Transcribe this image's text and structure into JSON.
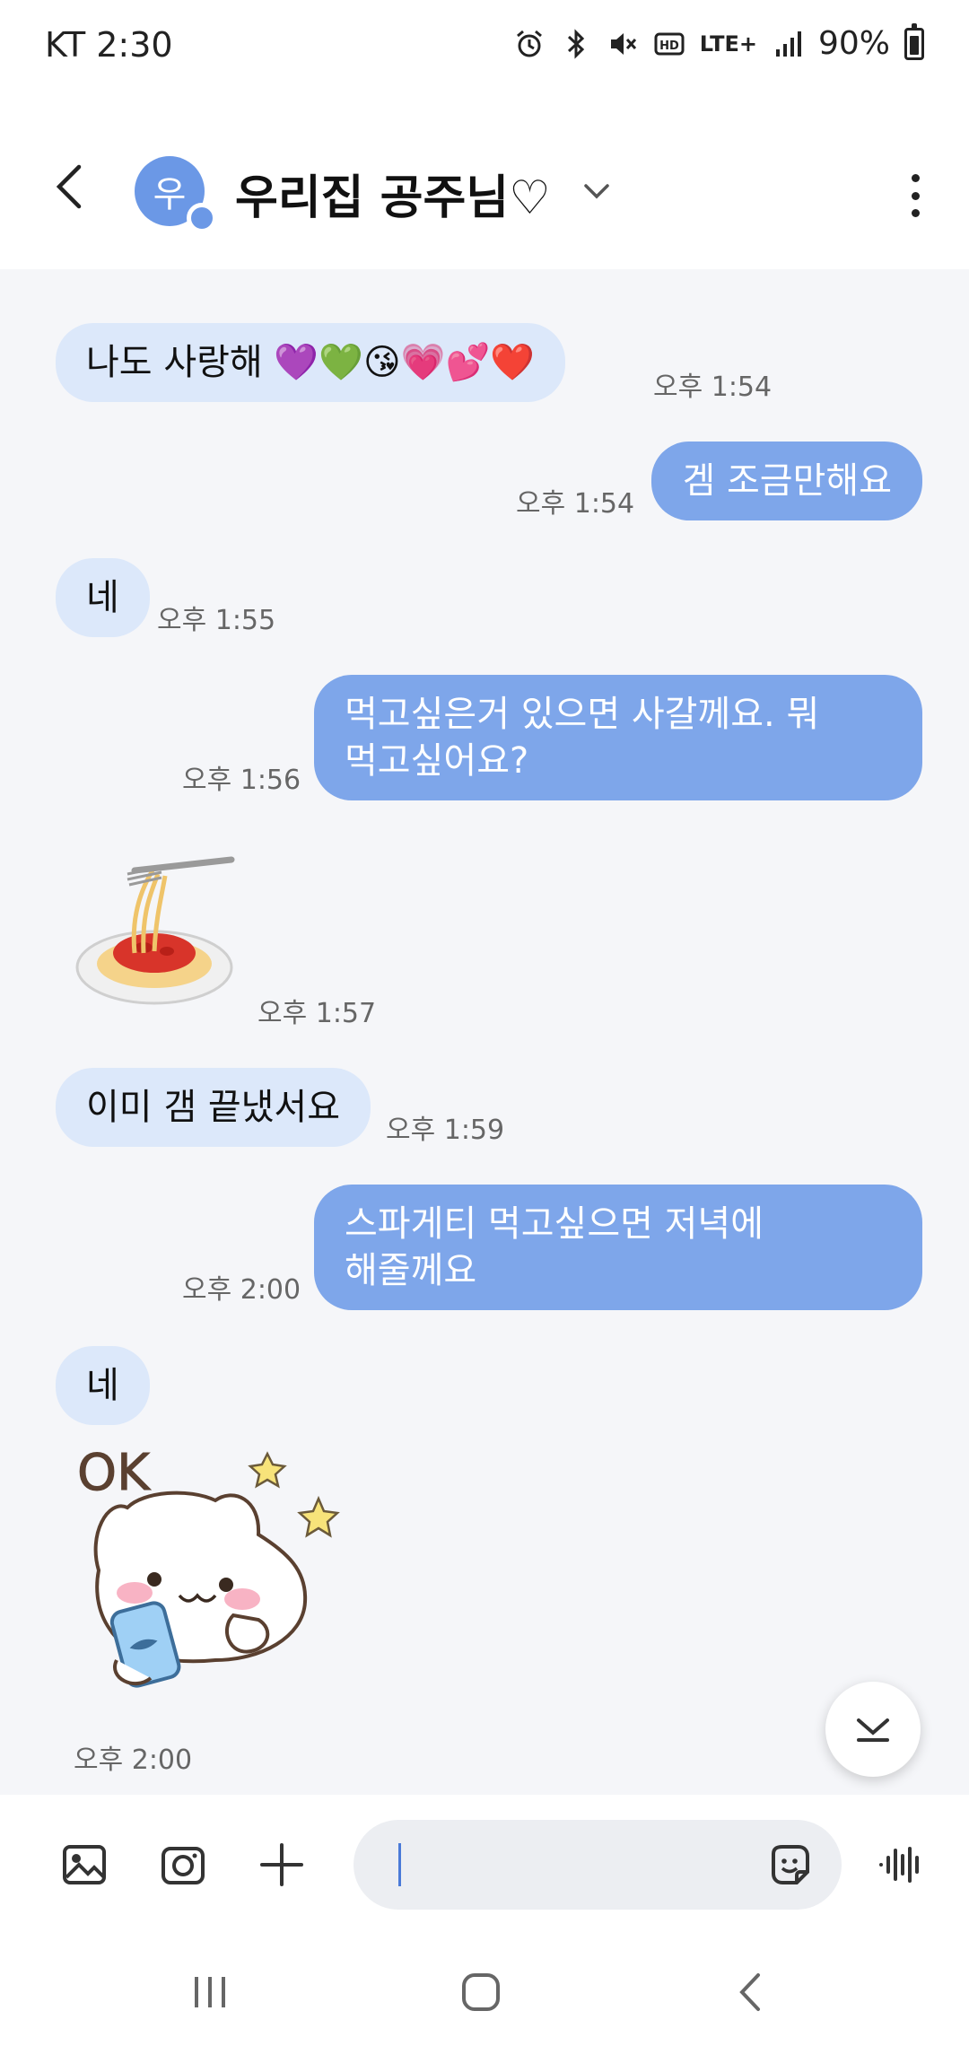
{
  "status_bar": {
    "carrier_time": "KT 2:30",
    "network": "LTE+",
    "battery": "90%"
  },
  "header": {
    "avatar_initial": "우",
    "title": "우리집 공주님♡"
  },
  "messages": [
    {
      "side": "in",
      "text": "나도 사랑해 💜💚😘💗💕❤️",
      "time": "오후 1:54"
    },
    {
      "side": "out",
      "text": "겜 조금만해요",
      "time": "오후 1:54"
    },
    {
      "side": "in",
      "text": "네",
      "time": "오후 1:55"
    },
    {
      "side": "out",
      "text_line1": "먹고싶은거 있으면 사갈께요. 뭐",
      "text_line2": "먹고싶어요?",
      "time": "오후 1:56"
    },
    {
      "side": "in",
      "type": "sticker",
      "sticker": "spaghetti",
      "time": "오후 1:57"
    },
    {
      "side": "in",
      "text": "이미 갬 끝냈서요",
      "time": "오후 1:59"
    },
    {
      "side": "out",
      "text_line1": "스파게티 먹고싶으면 저녁에",
      "text_line2": "해줄께요",
      "time": "오후 2:00"
    },
    {
      "side": "in",
      "text": "네",
      "time": ""
    },
    {
      "side": "in",
      "type": "sticker",
      "sticker": "ok-cat",
      "sticker_text": "OK",
      "time": "오후 2:00"
    }
  ],
  "input": {
    "placeholder": ""
  },
  "colors": {
    "incoming_bubble": "#dce8fa",
    "outgoing_bubble": "#7ea6ea",
    "avatar": "#6b98e6"
  }
}
